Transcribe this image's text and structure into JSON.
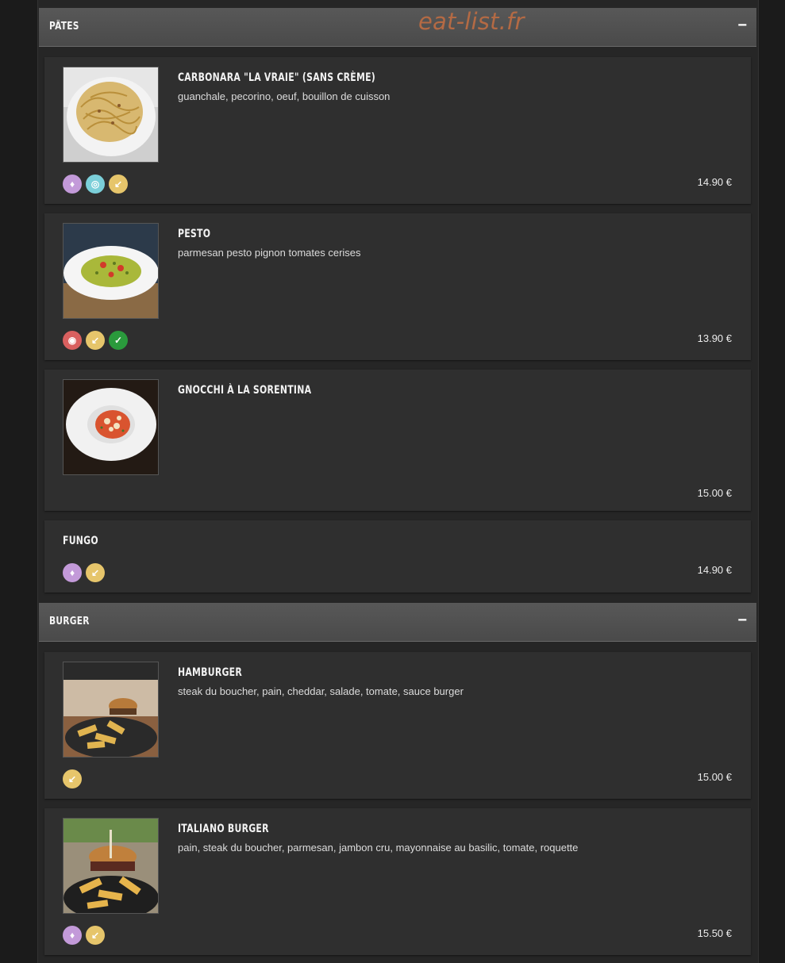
{
  "watermark": "eat-list.fr",
  "sections": [
    {
      "title": "PÂTES",
      "toggle": "−",
      "items": [
        {
          "name": "CARBONARA \"LA VRAIE\" (SANS CRÈME)",
          "description": "guanchale, pecorino, oeuf, bouillon de cuisson",
          "price": "14.90 €",
          "badges": [
            "purple-allergen-icon",
            "teal-allergen-icon",
            "gold-allergen-icon"
          ]
        },
        {
          "name": "PESTO",
          "description": "parmesan pesto pignon tomates cerises",
          "price": "13.90 €",
          "badges": [
            "red-allergen-icon",
            "gold-allergen-icon",
            "vegetarian-leaf-icon"
          ]
        },
        {
          "name": "GNOCCHI À LA SORENTINA",
          "description": "",
          "price": "15.00 €",
          "badges": []
        },
        {
          "name": "FUNGO",
          "description": "",
          "price": "14.90 €",
          "badges": [
            "purple-allergen-icon",
            "gold-allergen-icon"
          ]
        }
      ]
    },
    {
      "title": "BURGER",
      "toggle": "−",
      "items": [
        {
          "name": "HAMBURGER",
          "description": "steak du boucher, pain, cheddar, salade, tomate, sauce burger",
          "price": "15.00 €",
          "badges": [
            "gold-allergen-icon"
          ]
        },
        {
          "name": "ITALIANO BURGER",
          "description": "pain, steak du boucher, parmesan, jambon cru, mayonnaise au basilic, tomate, roquette",
          "price": "15.50 €",
          "badges": [
            "purple-allergen-icon",
            "gold-allergen-icon"
          ]
        }
      ]
    }
  ],
  "colors": {
    "accent_watermark": "#b46a44",
    "badge_purple": "#c39ad9",
    "badge_teal": "#7bcfd9",
    "badge_gold": "#e6c56b",
    "badge_red": "#d9605f",
    "badge_green": "#2a9a3c"
  }
}
